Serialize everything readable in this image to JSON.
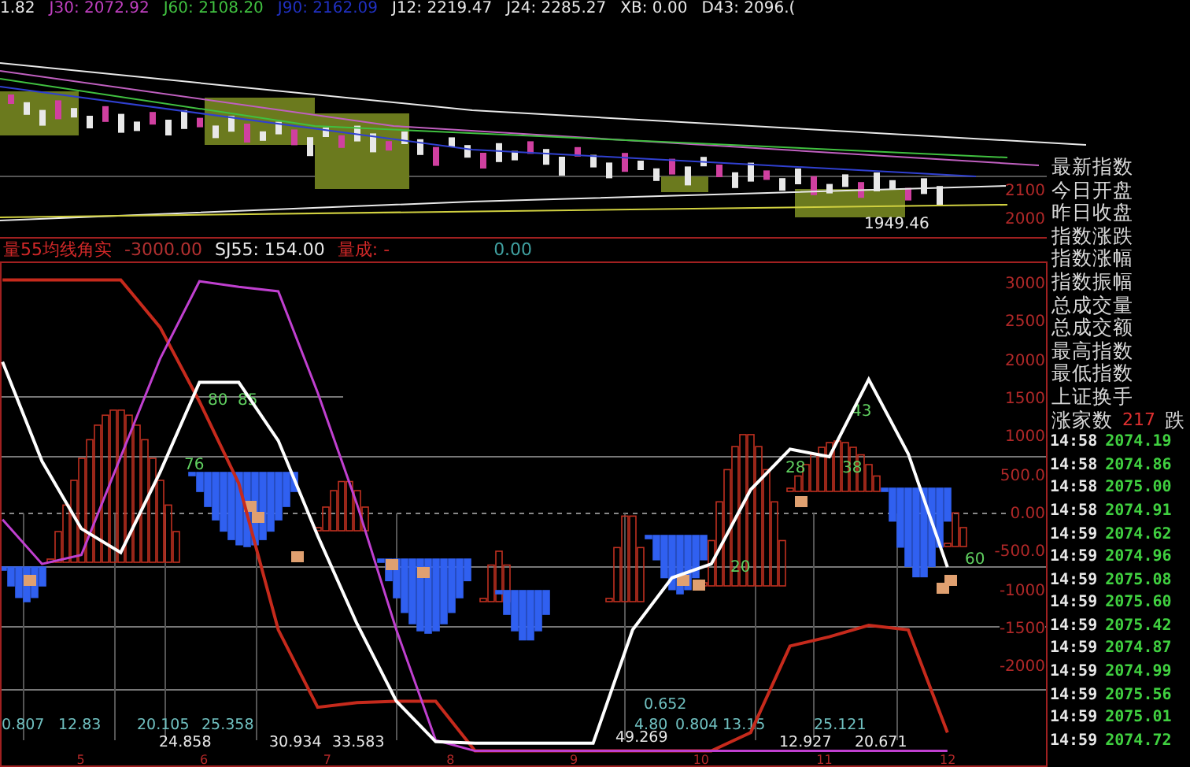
{
  "header": {
    "items": [
      {
        "text": "1.82",
        "color": "#e8e8e8"
      },
      {
        "text": "J30: 2072.92",
        "color": "#c040c0"
      },
      {
        "text": "J60: 2108.20",
        "color": "#40c040"
      },
      {
        "text": "J90: 2162.09",
        "color": "#2030c0"
      },
      {
        "text": "J12: 2219.47",
        "color": "#e8e8e8"
      },
      {
        "text": "J24: 2285.27",
        "color": "#e8e8e8"
      },
      {
        "text": "XB: 0.00",
        "color": "#e8e8e8"
      },
      {
        "text": "D43: 2096.(",
        "color": "#e8e8e8"
      }
    ]
  },
  "price_chart": {
    "axis_labels": [
      "2100",
      "2000"
    ],
    "low_label": "1949.46"
  },
  "indicator": {
    "header": [
      "量55均线角实",
      "-3000.00",
      "SJ55: 154.00",
      "量成: -",
      "0.00"
    ],
    "chart_data": {
      "type": "line",
      "x": [
        4.361,
        4.681,
        5.0,
        5.319,
        5.639,
        5.958,
        6.277,
        6.597,
        6.916,
        7.235,
        7.555,
        7.874,
        8.193,
        8.513,
        8.832,
        9.151,
        9.471,
        9.79,
        10.109,
        10.428,
        10.748,
        11.067,
        11.386,
        11.706,
        12.025
      ],
      "xlim": [
        4.34,
        12.83
      ],
      "ylim": [
        -3310,
        3290
      ],
      "xticks": [
        5,
        6,
        7,
        8,
        9,
        10,
        11,
        12
      ],
      "yticks": [
        3000,
        2500,
        2000,
        1500,
        1000,
        {
          "value": 500,
          "label": "500.0"
        },
        {
          "value": 0,
          "label": "0.00"
        },
        {
          "value": -500,
          "label": "-500.0"
        },
        -1000,
        -1500,
        -2000
      ],
      "series": [
        {
          "color": "#c62a1c",
          "values": [
            3050,
            3050,
            3050,
            3050,
            2430,
            1460,
            390,
            -1520,
            -2530,
            -2470,
            -2450,
            -2450,
            -3100,
            -3100,
            -3100,
            -3100,
            -3100,
            -3100,
            -3100,
            -2860,
            -1730,
            -1610,
            -1460,
            -1520,
            -2860
          ]
        },
        {
          "color": "#c040d0",
          "values": [
            -80,
            -660,
            -540,
            740,
            2020,
            3030,
            2960,
            2900,
            1580,
            120,
            -1520,
            -2960,
            -3100,
            -3100,
            -3100,
            -3100,
            -3100,
            -3100,
            -3100,
            -3100,
            -3100,
            -3100,
            -3100,
            -3100,
            -3100
          ]
        },
        {
          "color": "#ffffff",
          "values": [
            1980,
            680,
            -200,
            -510,
            540,
            1710,
            1710,
            950,
            -290,
            -1440,
            -2450,
            -2980,
            -3000,
            -3000,
            -3000,
            -3000,
            -1520,
            -840,
            -660,
            310,
            840,
            740,
            1750,
            780,
            -700
          ]
        }
      ]
    },
    "point_labels": [
      "80",
      "85",
      "76",
      "43",
      "28",
      "38",
      "20",
      "60"
    ],
    "bottom_labels": [
      "0.807",
      "12.83",
      "20.105",
      "25.358",
      "0.652",
      "4.80",
      "0.804",
      "13.15",
      "25.121",
      "24.858",
      "30.934",
      "33.583",
      "49.269",
      "12.927",
      "20.671"
    ]
  },
  "quote_panel": {
    "fields": [
      "最新指数",
      "今日开盘",
      "昨日收盘",
      "指数涨跌",
      "指数涨幅",
      "指数振幅",
      "总成交量",
      "总成交额",
      "最高指数",
      "最低指数",
      "上证换手"
    ],
    "advancers": {
      "label": "涨家数",
      "value": "217",
      "next_label": "跌"
    },
    "ticks": [
      {
        "time": "14:58",
        "price": "2074.19"
      },
      {
        "time": "14:58",
        "price": "2074.86"
      },
      {
        "time": "14:58",
        "price": "2075.00"
      },
      {
        "time": "14:58",
        "price": "2074.91"
      },
      {
        "time": "14:59",
        "price": "2074.62"
      },
      {
        "time": "14:59",
        "price": "2074.96"
      },
      {
        "time": "14:59",
        "price": "2075.08"
      },
      {
        "time": "14:59",
        "price": "2075.60"
      },
      {
        "time": "14:59",
        "price": "2075.42"
      },
      {
        "time": "14:59",
        "price": "2074.87"
      },
      {
        "time": "14:59",
        "price": "2074.99"
      },
      {
        "time": "14:59",
        "price": "2075.56"
      },
      {
        "time": "14:59",
        "price": "2075.01"
      },
      {
        "time": "14:59",
        "price": "2074.72"
      }
    ]
  }
}
